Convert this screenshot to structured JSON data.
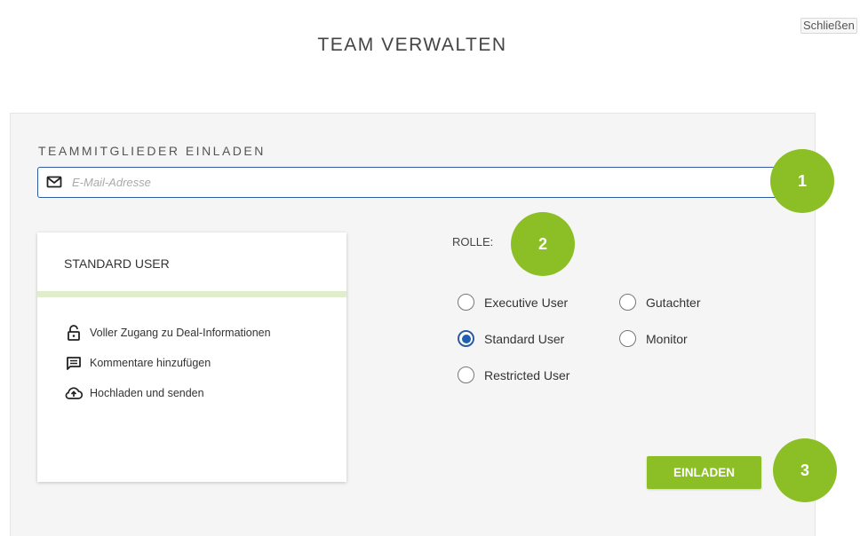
{
  "header": {
    "close_label": "Schließen",
    "title": "TEAM VERWALTEN"
  },
  "invite": {
    "section_label": "TEAMMITGLIEDER EINLADEN",
    "email_placeholder": "E-Mail-Adresse",
    "email_value": ""
  },
  "role_card": {
    "title": "STANDARD USER",
    "permissions": [
      {
        "icon": "lock-open-icon",
        "label": "Voller Zugang zu Deal-Informationen"
      },
      {
        "icon": "comment-icon",
        "label": "Kommentare hinzufügen"
      },
      {
        "icon": "cloud-upload-icon",
        "label": "Hochladen und senden"
      }
    ]
  },
  "roles": {
    "label": "ROLLE:",
    "options": [
      {
        "label": "Executive User",
        "checked": false
      },
      {
        "label": "Gutachter",
        "checked": false
      },
      {
        "label": "Standard User",
        "checked": true
      },
      {
        "label": "Monitor",
        "checked": false
      },
      {
        "label": "Restricted User",
        "checked": false
      }
    ]
  },
  "actions": {
    "invite_label": "EINLADEN"
  },
  "badges": [
    "1",
    "2",
    "3"
  ],
  "colors": {
    "accent_green": "#8cbf26",
    "focus_blue": "#2d5aa0",
    "card_bar": "#e0eecb"
  }
}
